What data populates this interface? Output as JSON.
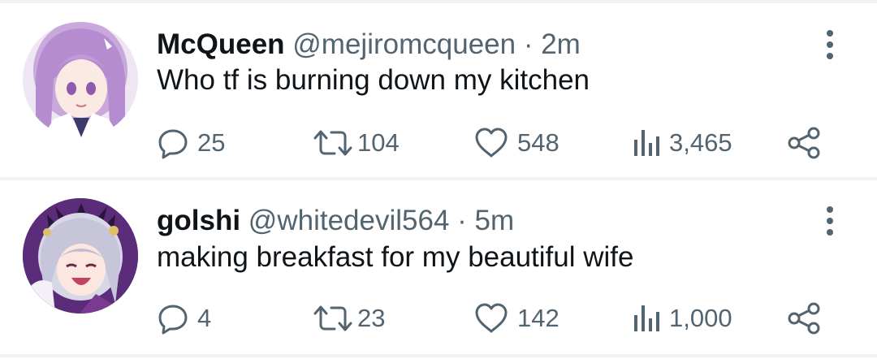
{
  "tweets": [
    {
      "display_name": "McQueen",
      "handle": "@mejiromcqueen",
      "separator": "·",
      "time": "2m",
      "text": "Who tf is burning down my kitchen",
      "replies": "25",
      "retweets": "104",
      "likes": "548",
      "views": "3,465",
      "avatar_description_icon": "avatar-icon"
    },
    {
      "display_name": "golshi",
      "handle": "@whitedevil564",
      "separator": "·",
      "time": "5m",
      "text": "making breakfast for my beautiful wife",
      "replies": "4",
      "retweets": "23",
      "likes": "142",
      "views": "1,000",
      "avatar_description_icon": "avatar-icon"
    }
  ],
  "colors": {
    "text_primary": "#0f1419",
    "text_secondary": "#536471",
    "separator": "#eff3f4"
  },
  "icons": [
    "reply-icon",
    "retweet-icon",
    "like-icon",
    "views-icon",
    "share-icon",
    "more-icon"
  ]
}
